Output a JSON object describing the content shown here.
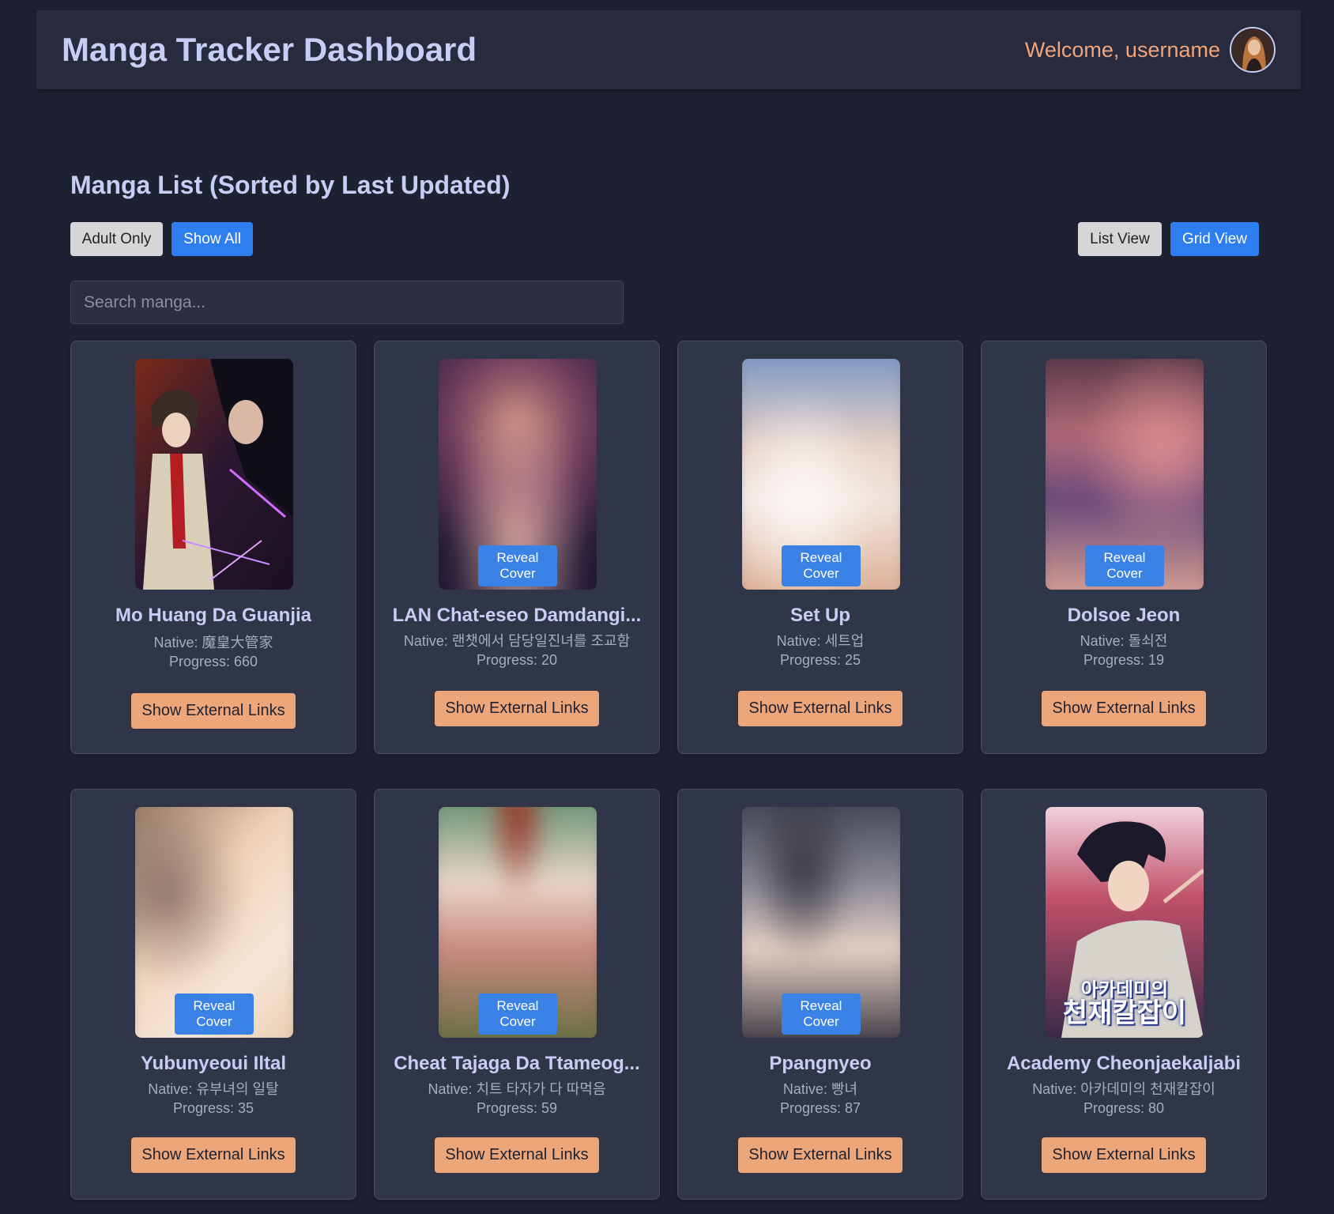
{
  "header": {
    "title": "Manga Tracker Dashboard",
    "welcome": "Welcome, username"
  },
  "section": {
    "title": "Manga List (Sorted by Last Updated)"
  },
  "filters": {
    "adult_only": "Adult Only",
    "show_all": "Show All",
    "list_view": "List View",
    "grid_view": "Grid View"
  },
  "search": {
    "placeholder": "Search manga..."
  },
  "reveal_label": "Reveal Cover",
  "links_label": "Show External Links",
  "manga": [
    {
      "title": "Mo Huang Da Guanjia",
      "native": "Native: 魔皇大管家",
      "progress": "Progress: 660",
      "blurred": false
    },
    {
      "title": "LAN Chat-eseo Damdangi...",
      "native": "Native: 랜챗에서 담당일진녀를 조교함",
      "progress": "Progress: 20",
      "blurred": true
    },
    {
      "title": "Set Up",
      "native": "Native: 세트업",
      "progress": "Progress: 25",
      "blurred": true
    },
    {
      "title": "Dolsoe Jeon",
      "native": "Native: 돌쇠전",
      "progress": "Progress: 19",
      "blurred": true
    },
    {
      "title": "Yubunyeoui Iltal",
      "native": "Native: 유부녀의 일탈",
      "progress": "Progress: 35",
      "blurred": true
    },
    {
      "title": "Cheat Tajaga Da Ttameog...",
      "native": "Native: 치트 타자가 다 따먹음",
      "progress": "Progress: 59",
      "blurred": true
    },
    {
      "title": "Ppangnyeo",
      "native": "Native: 빵녀",
      "progress": "Progress: 87",
      "blurred": true
    },
    {
      "title": "Academy Cheonjaekaljabi",
      "native": "Native: 아카데미의 천재칼잡이",
      "progress": "Progress: 80",
      "blurred": false,
      "cover_text": [
        "아카데미의",
        "천재칼잡이"
      ]
    }
  ],
  "colors": {
    "background": "#1e2132",
    "card": "#313548",
    "accent_blue": "#2f7ef0",
    "accent_orange": "#eda67a",
    "welcome": "#f0a57c"
  }
}
